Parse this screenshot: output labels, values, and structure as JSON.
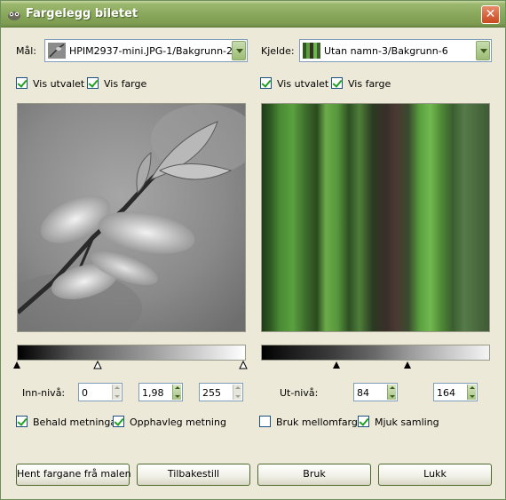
{
  "window": {
    "title": "Fargelegg biletet",
    "close_label": "✕"
  },
  "target": {
    "label": "Mål:",
    "image_name": "HPIM2937-mini.JPG-1/Bakgrunn-2",
    "show_selection_label": "Vis utvalet",
    "show_selection_checked": true,
    "show_color_label": "Vis farge",
    "show_color_checked": true
  },
  "source": {
    "label": "Kjelde:",
    "image_name": "Utan namn-3/Bakgrunn-6",
    "show_selection_label": "Vis utvalet",
    "show_selection_checked": true,
    "show_color_label": "Vis farge",
    "show_color_checked": true
  },
  "input_levels": {
    "label": "Inn-nivå:",
    "low": "0",
    "gamma": "1,98",
    "high": "255"
  },
  "output_levels": {
    "label": "Ut-nivå:",
    "low": "84",
    "high": "164"
  },
  "options": {
    "keep_saturation": {
      "label": "Behald metninga",
      "checked": true
    },
    "original_saturation": {
      "label": "Opphavleg metning",
      "checked": true
    },
    "use_subcolors": {
      "label": "Bruk mellomfarger",
      "checked": false
    },
    "smooth_samples": {
      "label": "Mjuk samling",
      "checked": true
    }
  },
  "buttons": {
    "get_colors": "Hent fargane frå malen",
    "reset": "Tilbakestill",
    "apply": "Bruk",
    "close": "Lukk"
  },
  "colors": {
    "accent_green": "#8aa95c",
    "dialog_bg": "#ece9d8"
  },
  "icons": {
    "app": "gimp-wilber-icon",
    "close": "close-icon",
    "dropdown": "chevron-down-icon"
  }
}
